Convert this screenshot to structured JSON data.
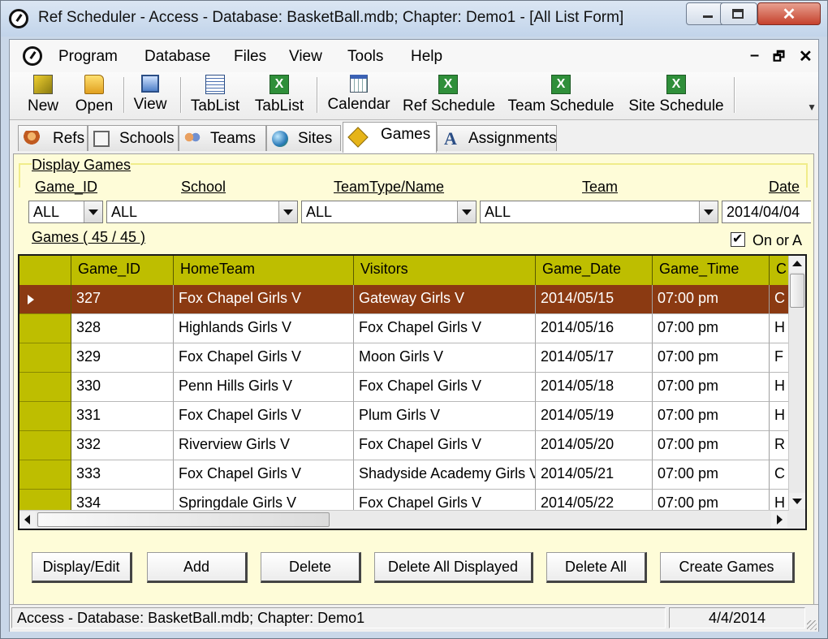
{
  "window": {
    "title": "Ref Scheduler - Access - Database: BasketBall.mdb; Chapter: Demo1 - [All List Form]"
  },
  "menu": {
    "items": [
      "Program",
      "Database",
      "Files",
      "View",
      "Tools",
      "Help"
    ],
    "mdi_minimize": "–",
    "mdi_restore": "🗗",
    "mdi_close": "✕"
  },
  "toolbar": {
    "buttons": [
      {
        "label": "New",
        "icon": "new-database-icon"
      },
      {
        "label": "Open",
        "icon": "open-folder-icon"
      },
      {
        "label": "View",
        "icon": "view-window-icon"
      },
      {
        "label": "TabList",
        "icon": "tablist-icon"
      },
      {
        "label": "TabList",
        "icon": "excel-icon"
      },
      {
        "label": "Calendar",
        "icon": "calendar-icon"
      },
      {
        "label": "Ref Schedule",
        "icon": "excel-icon"
      },
      {
        "label": "Team Schedule",
        "icon": "excel-icon"
      },
      {
        "label": "Site Schedule",
        "icon": "excel-icon"
      }
    ]
  },
  "tabs": [
    {
      "label": "Refs",
      "icon": "refs-icon"
    },
    {
      "label": "Schools",
      "icon": "schools-icon"
    },
    {
      "label": "Teams",
      "icon": "teams-icon"
    },
    {
      "label": "Sites",
      "icon": "globe-icon"
    },
    {
      "label": "Games",
      "icon": "games-icon",
      "active": true
    },
    {
      "label": "Assignments",
      "icon": "assignments-icon"
    }
  ],
  "filters": {
    "group_label": "Display Games",
    "game_id": {
      "label": "Game_ID",
      "value": "ALL"
    },
    "school": {
      "label": "School",
      "value": "ALL"
    },
    "team_type": {
      "label": "TeamType/Name",
      "value": "ALL"
    },
    "team": {
      "label": "Team",
      "value": "ALL"
    },
    "date": {
      "label": "Date",
      "value": "2014/04/04"
    },
    "on_or_after": {
      "label": "On or A",
      "checked": true
    }
  },
  "games_count_label": "Games  ( 45 / 45 )",
  "grid": {
    "columns": [
      "Game_ID",
      "HomeTeam",
      "Visitors",
      "Game_Date",
      "Game_Time",
      "C"
    ],
    "rows": [
      [
        "327",
        "Fox Chapel Girls V",
        "Gateway Girls V",
        "2014/05/15",
        "07:00 pm",
        "C"
      ],
      [
        "328",
        "Highlands Girls V",
        "Fox Chapel Girls V",
        "2014/05/16",
        "07:00 pm",
        "H"
      ],
      [
        "329",
        "Fox Chapel Girls V",
        "Moon Girls V",
        "2014/05/17",
        "07:00 pm",
        "F"
      ],
      [
        "330",
        "Penn Hills Girls V",
        "Fox Chapel Girls V",
        "2014/05/18",
        "07:00 pm",
        "H"
      ],
      [
        "331",
        "Fox Chapel Girls V",
        "Plum Girls V",
        "2014/05/19",
        "07:00 pm",
        "H"
      ],
      [
        "332",
        "Riverview Girls V",
        "Fox Chapel Girls V",
        "2014/05/20",
        "07:00 pm",
        "R"
      ],
      [
        "333",
        "Fox Chapel Girls V",
        "Shadyside Academy Girls V",
        "2014/05/21",
        "07:00 pm",
        "C"
      ],
      [
        "334",
        "Springdale Girls V",
        "Fox Chapel Girls V",
        "2014/05/22",
        "07:00 pm",
        "H"
      ]
    ],
    "selected_row": 0
  },
  "buttons": {
    "display_edit": "Display/Edit",
    "add": "Add",
    "delete": "Delete",
    "delete_all_displayed": "Delete All Displayed",
    "delete_all": "Delete All",
    "create_games": "Create Games"
  },
  "status": {
    "text": "Access - Database: BasketBall.mdb; Chapter: Demo1",
    "date": "4/4/2014"
  },
  "colors": {
    "panel_bg": "#fefcd8",
    "header_bg": "#bebe00",
    "selected_row_bg": "#8b3a12"
  }
}
